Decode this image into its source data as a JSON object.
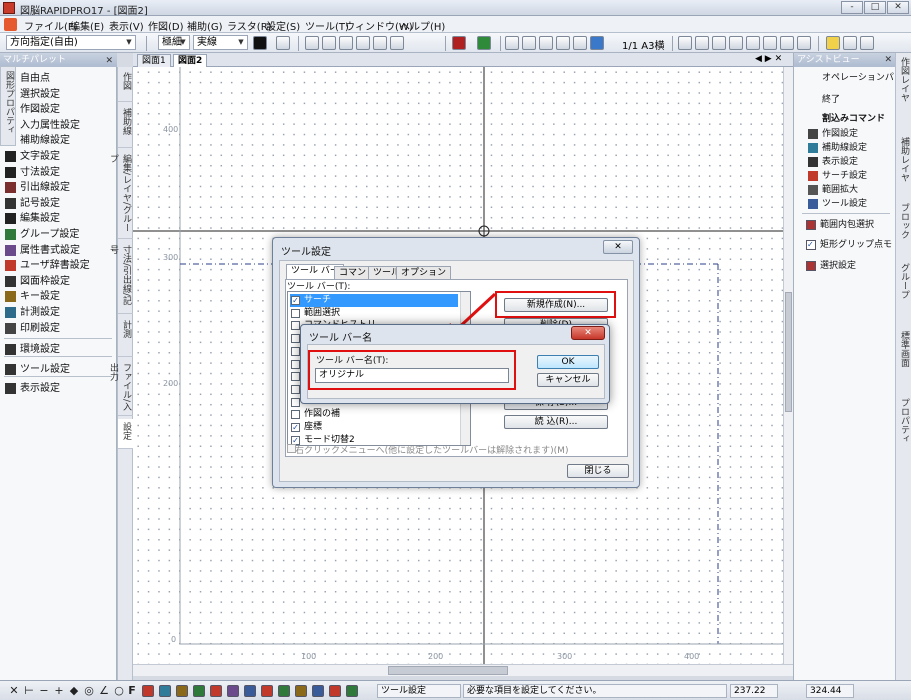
{
  "window": {
    "title": "図脳RAPIDPRO17 - [図面2]",
    "controls": [
      "-",
      "□",
      "✕"
    ]
  },
  "menu": [
    "ファイル(F)",
    "編集(E)",
    "表示(V)",
    "作図(D)",
    "補助(G)",
    "ラスタ(R)",
    "設定(S)",
    "ツール(T)",
    "ウィンドウ(W)",
    "ヘルプ(H)"
  ],
  "toolbar": {
    "direction_combo": "方向指定(自由)",
    "line_width_combo": "極細",
    "line_type_combo": "実線",
    "scale_text": "1/1 A3横"
  },
  "left_palette": {
    "title": "マルチパレット",
    "strip_text": "図形プロパティ",
    "items": [
      "自由点",
      "選択設定",
      "作図設定",
      "入力属性設定",
      "補助線設定",
      "文字設定",
      "寸法設定",
      "引出線設定",
      "記号設定",
      "編集設定",
      "グループ設定",
      "属性書式設定",
      "ユーザ辞書設定",
      "図面枠設定",
      "キー設定",
      "計測設定",
      "印刷設定",
      "環境設定",
      "ツール設定",
      "表示設定"
    ]
  },
  "vertical_tabs": [
    "作図",
    "補助線",
    "編集/レイヤ/グループ",
    "寸法/引出線/記号",
    "計測",
    "ファイル/入出力",
    "設定"
  ],
  "doc_tabs": [
    "図面1",
    "図面2"
  ],
  "canvas": {
    "y_ticks": [
      "400",
      "300",
      "200",
      "0"
    ],
    "x_ticks": [
      "100",
      "200",
      "300",
      "400"
    ]
  },
  "right_panel": {
    "title": "アシストビュー",
    "ops": [
      "オペレーションパッ...",
      "終了"
    ],
    "section": "割込みコマンド",
    "commands": [
      "作図設定",
      "補助線設定",
      "表示設定",
      "サーチ設定",
      "範囲拡大",
      "ツール設定"
    ],
    "extra": [
      "範囲内包選択",
      "矩形グリップ点モ...",
      "選択設定"
    ],
    "strip_tabs": [
      "作図レイヤ",
      "補助レイヤ",
      "ブロック",
      "グループ",
      "標準画面",
      "プロパティ"
    ]
  },
  "dialog": {
    "title": "ツール設定",
    "tabs": [
      "ツール バー",
      "コマンド",
      "ツール",
      "オプション"
    ],
    "list_label": "ツール バー(T):",
    "list_items": [
      {
        "label": "サーチ",
        "checked": true,
        "selected": true
      },
      {
        "label": "範囲選択",
        "checked": false
      },
      {
        "label": "コマンドヒストリ",
        "checked": false
      },
      {
        "label": "",
        "checked": false
      },
      {
        "label": "",
        "checked": false
      },
      {
        "label": "",
        "checked": false
      },
      {
        "label": "",
        "checked": false
      },
      {
        "label": "",
        "checked": false
      },
      {
        "label": "",
        "checked": false
      },
      {
        "label": "作図の補",
        "checked": false
      },
      {
        "label": "座標",
        "checked": true
      },
      {
        "label": "モード切替2",
        "checked": true
      }
    ],
    "buttons": {
      "new": "新規作成(N)...",
      "delete": "削除(D)",
      "save": "保 存(S)...",
      "load": "読 込(R)...",
      "close": "閉じる"
    },
    "right_click_label": "右クリックメニューへ(他に設定したツールバーは解除されます)(M)"
  },
  "subdialog": {
    "title": "ツール バー名",
    "field_label": "ツール バー名(T):",
    "field_value": "オリジナル",
    "ok": "OK",
    "cancel": "キャンセル"
  },
  "statusbar": {
    "message_label": "ツール設定",
    "message": "必要な項目を設定してください。",
    "coord_x": "237.22",
    "coord_y": "324.44"
  },
  "colors": {
    "highlight": "#e01010",
    "selection": "#3399ff"
  }
}
